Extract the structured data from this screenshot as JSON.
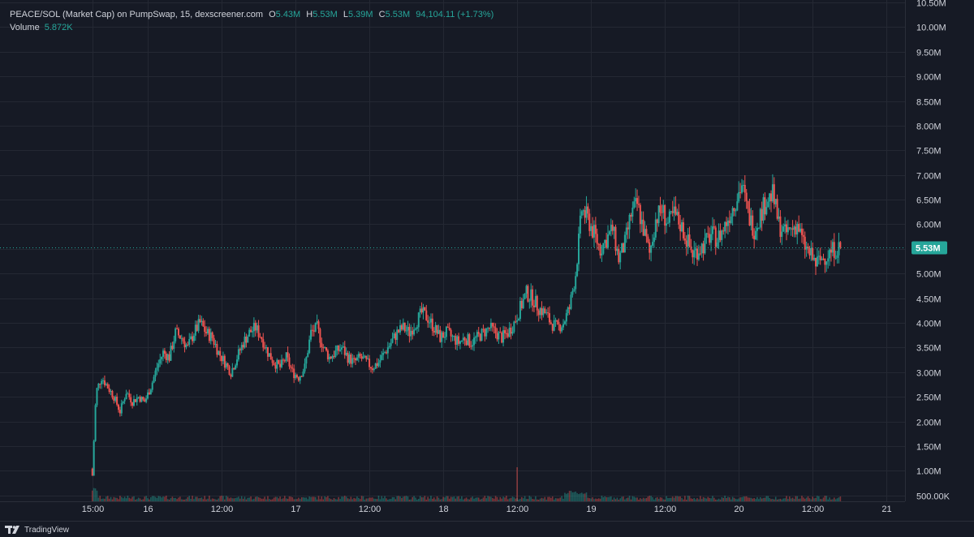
{
  "header": {
    "symbol": "PEACE/SOL (Market Cap) on PumpSwap, 15, dexscreener.com",
    "open_label": "O",
    "open": "5.43M",
    "high_label": "H",
    "high": "5.53M",
    "low_label": "L",
    "low": "5.39M",
    "close_label": "C",
    "close": "5.53M",
    "change": "94,104.11 (+1.73%)",
    "volume_label": "Volume",
    "volume_value": "5.872K"
  },
  "footer": {
    "brand": "TradingView"
  },
  "colors": {
    "up": "#26a69a",
    "down": "#ef5350",
    "bg": "#161a25",
    "grid": "#242833",
    "price_tag": "#26a69a"
  },
  "chart_data": {
    "type": "candlestick",
    "current_price": 5.53,
    "current_price_label": "5.53M",
    "y_axis": {
      "unit": "M",
      "ylim": [
        0.38,
        10.55
      ],
      "ticks": [
        10.5,
        10.0,
        9.5,
        9.0,
        8.5,
        8.0,
        7.5,
        7.0,
        6.5,
        6.0,
        5.5,
        5.0,
        4.5,
        4.0,
        3.5,
        3.0,
        2.5,
        2.0,
        1.5,
        1.0,
        0.5
      ],
      "tick_labels": [
        "10.50M",
        "10.00M",
        "9.50M",
        "9.00M",
        "8.50M",
        "8.00M",
        "7.50M",
        "7.00M",
        "6.50M",
        "6.00M",
        "5.50M",
        "5.00M",
        "4.50M",
        "4.00M",
        "3.50M",
        "3.00M",
        "2.50M",
        "2.00M",
        "1.50M",
        "1.00M",
        "500.00K"
      ]
    },
    "x_axis": {
      "unit": "hours since 15:00 on day 15",
      "xlim": [
        -15,
        132
      ],
      "ticks": [
        0,
        9,
        21,
        33,
        45,
        57,
        69,
        81,
        93,
        105,
        117,
        129
      ],
      "tick_labels": [
        "15:00",
        "16",
        "12:00",
        "17",
        "12:00",
        "18",
        "12:00",
        "19",
        "12:00",
        "20",
        "12:00",
        "21"
      ]
    },
    "price_path": [
      {
        "x": 0,
        "y": 0.9
      },
      {
        "x": 0.6,
        "y": 2.6
      },
      {
        "x": 1.5,
        "y": 2.9
      },
      {
        "x": 2.5,
        "y": 2.7
      },
      {
        "x": 3.5,
        "y": 2.5
      },
      {
        "x": 4.5,
        "y": 2.2
      },
      {
        "x": 5.5,
        "y": 2.6
      },
      {
        "x": 6.5,
        "y": 2.4
      },
      {
        "x": 7.5,
        "y": 2.5
      },
      {
        "x": 8.5,
        "y": 2.4
      },
      {
        "x": 9.5,
        "y": 2.7
      },
      {
        "x": 10.5,
        "y": 3.1
      },
      {
        "x": 11.5,
        "y": 3.4
      },
      {
        "x": 12.5,
        "y": 3.3
      },
      {
        "x": 13.5,
        "y": 3.8
      },
      {
        "x": 14.5,
        "y": 3.7
      },
      {
        "x": 15.5,
        "y": 3.5
      },
      {
        "x": 16.5,
        "y": 3.8
      },
      {
        "x": 17.5,
        "y": 4.0
      },
      {
        "x": 18.5,
        "y": 3.8
      },
      {
        "x": 19.5,
        "y": 3.7
      },
      {
        "x": 20.5,
        "y": 3.4
      },
      {
        "x": 21.5,
        "y": 3.2
      },
      {
        "x": 22.5,
        "y": 3.0
      },
      {
        "x": 23.5,
        "y": 3.3
      },
      {
        "x": 24.5,
        "y": 3.6
      },
      {
        "x": 25.5,
        "y": 3.8
      },
      {
        "x": 26.5,
        "y": 3.9
      },
      {
        "x": 27.5,
        "y": 3.7
      },
      {
        "x": 28.5,
        "y": 3.4
      },
      {
        "x": 29.5,
        "y": 3.2
      },
      {
        "x": 30.5,
        "y": 3.1
      },
      {
        "x": 31.5,
        "y": 3.3
      },
      {
        "x": 32.5,
        "y": 3.0
      },
      {
        "x": 33.5,
        "y": 2.9
      },
      {
        "x": 34.5,
        "y": 3.1
      },
      {
        "x": 35.5,
        "y": 3.8
      },
      {
        "x": 36.5,
        "y": 3.9
      },
      {
        "x": 37.5,
        "y": 3.5
      },
      {
        "x": 38.5,
        "y": 3.3
      },
      {
        "x": 39.5,
        "y": 3.4
      },
      {
        "x": 40.5,
        "y": 3.5
      },
      {
        "x": 41.5,
        "y": 3.3
      },
      {
        "x": 42.5,
        "y": 3.2
      },
      {
        "x": 43.5,
        "y": 3.3
      },
      {
        "x": 44.5,
        "y": 3.2
      },
      {
        "x": 45.5,
        "y": 3.1
      },
      {
        "x": 46.5,
        "y": 3.2
      },
      {
        "x": 47.5,
        "y": 3.4
      },
      {
        "x": 48.5,
        "y": 3.6
      },
      {
        "x": 49.5,
        "y": 3.8
      },
      {
        "x": 50.5,
        "y": 3.9
      },
      {
        "x": 51.5,
        "y": 3.8
      },
      {
        "x": 52.5,
        "y": 4.0
      },
      {
        "x": 53.5,
        "y": 4.2
      },
      {
        "x": 54.5,
        "y": 4.1
      },
      {
        "x": 55.5,
        "y": 3.9
      },
      {
        "x": 56.5,
        "y": 3.7
      },
      {
        "x": 57.5,
        "y": 3.8
      },
      {
        "x": 58.5,
        "y": 3.7
      },
      {
        "x": 59.5,
        "y": 3.6
      },
      {
        "x": 60.5,
        "y": 3.7
      },
      {
        "x": 61.5,
        "y": 3.6
      },
      {
        "x": 62.5,
        "y": 3.7
      },
      {
        "x": 63.5,
        "y": 3.8
      },
      {
        "x": 64.5,
        "y": 3.9
      },
      {
        "x": 65.5,
        "y": 3.8
      },
      {
        "x": 66.5,
        "y": 3.7
      },
      {
        "x": 67.5,
        "y": 3.8
      },
      {
        "x": 68.5,
        "y": 4.0
      },
      {
        "x": 69.5,
        "y": 4.3
      },
      {
        "x": 70.5,
        "y": 4.6
      },
      {
        "x": 71.5,
        "y": 4.5
      },
      {
        "x": 72.5,
        "y": 4.3
      },
      {
        "x": 73.5,
        "y": 4.2
      },
      {
        "x": 74.5,
        "y": 4.0
      },
      {
        "x": 75.5,
        "y": 3.9
      },
      {
        "x": 76.5,
        "y": 4.0
      },
      {
        "x": 77.5,
        "y": 4.3
      },
      {
        "x": 78.5,
        "y": 5.0
      },
      {
        "x": 79.5,
        "y": 6.3
      },
      {
        "x": 80.5,
        "y": 6.1
      },
      {
        "x": 81.5,
        "y": 5.8
      },
      {
        "x": 82.5,
        "y": 5.5
      },
      {
        "x": 83.5,
        "y": 5.7
      },
      {
        "x": 84.5,
        "y": 5.9
      },
      {
        "x": 85.5,
        "y": 5.3
      },
      {
        "x": 86.5,
        "y": 5.6
      },
      {
        "x": 87.5,
        "y": 6.2
      },
      {
        "x": 88.5,
        "y": 6.4
      },
      {
        "x": 89.5,
        "y": 5.9
      },
      {
        "x": 90.5,
        "y": 5.4
      },
      {
        "x": 91.5,
        "y": 6.1
      },
      {
        "x": 92.5,
        "y": 6.3
      },
      {
        "x": 93.5,
        "y": 6.0
      },
      {
        "x": 94.5,
        "y": 6.2
      },
      {
        "x": 95.5,
        "y": 6.0
      },
      {
        "x": 96.5,
        "y": 5.7
      },
      {
        "x": 97.5,
        "y": 5.4
      },
      {
        "x": 98.5,
        "y": 5.5
      },
      {
        "x": 99.5,
        "y": 5.6
      },
      {
        "x": 100.5,
        "y": 5.8
      },
      {
        "x": 101.5,
        "y": 5.7
      },
      {
        "x": 102.5,
        "y": 5.9
      },
      {
        "x": 103.5,
        "y": 6.2
      },
      {
        "x": 104.5,
        "y": 6.5
      },
      {
        "x": 105.5,
        "y": 6.8
      },
      {
        "x": 106.5,
        "y": 6.2
      },
      {
        "x": 107.5,
        "y": 5.9
      },
      {
        "x": 108.5,
        "y": 6.2
      },
      {
        "x": 109.5,
        "y": 6.5
      },
      {
        "x": 110.5,
        "y": 6.6
      },
      {
        "x": 111.5,
        "y": 6.0
      },
      {
        "x": 112.5,
        "y": 5.8
      },
      {
        "x": 113.5,
        "y": 5.9
      },
      {
        "x": 114.5,
        "y": 6.0
      },
      {
        "x": 115.5,
        "y": 5.6
      },
      {
        "x": 116.5,
        "y": 5.4
      },
      {
        "x": 117.5,
        "y": 5.2
      },
      {
        "x": 118.5,
        "y": 5.3
      },
      {
        "x": 119.5,
        "y": 5.4
      },
      {
        "x": 120.5,
        "y": 5.5
      },
      {
        "x": 121.5,
        "y": 5.53
      }
    ],
    "grid": true,
    "legend": "top-left"
  }
}
